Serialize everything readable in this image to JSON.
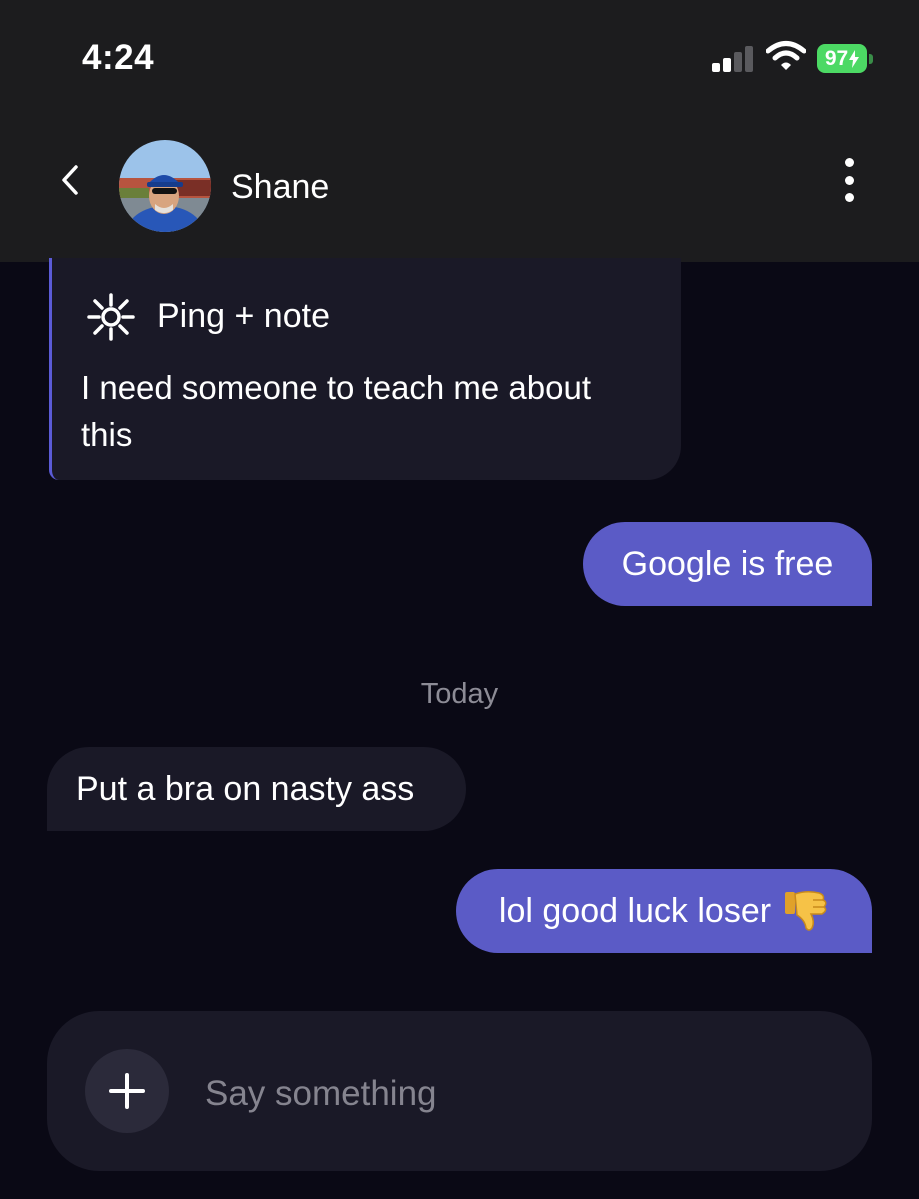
{
  "status_bar": {
    "time": "4:24",
    "battery_level": "97",
    "cellular_bars": 2,
    "cellular_total": 4,
    "battery_color": "#4cd964"
  },
  "header": {
    "back_icon": "chevron-left-icon",
    "contact_name": "Shane",
    "menu_icon": "vertical-dots-icon"
  },
  "conversation": {
    "ping_card": {
      "icon": "sun-burst-icon",
      "title": "Ping + note",
      "note": "I need someone to teach me about this"
    },
    "messages": [
      {
        "direction": "outgoing",
        "text": "Google is free"
      },
      {
        "direction": "incoming",
        "text": "Put a bra on nasty ass"
      },
      {
        "direction": "outgoing",
        "text": "lol good luck loser",
        "emoji": "thumbs-down-icon"
      }
    ],
    "date_separator": "Today"
  },
  "composer": {
    "add_icon": "plus-icon",
    "placeholder": "Say something",
    "value": ""
  },
  "colors": {
    "background": "#0a0915",
    "header_bg": "#1c1c1e",
    "outgoing_bubble": "#5b5bc6",
    "incoming_bubble": "#1a1927",
    "accent": "#5b5bd6"
  }
}
